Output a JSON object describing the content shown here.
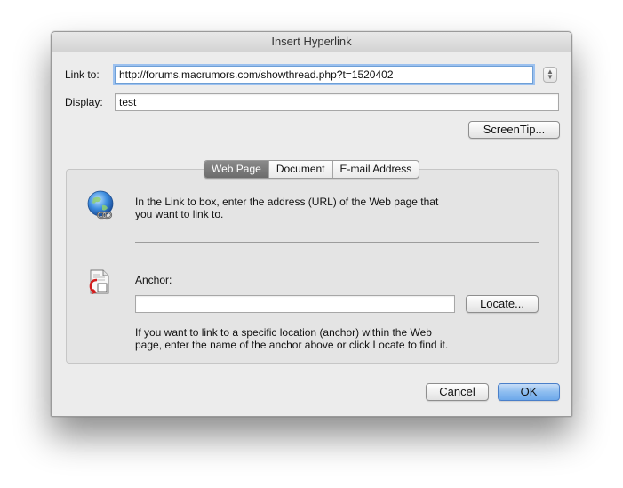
{
  "window": {
    "title": "Insert Hyperlink"
  },
  "link_to": {
    "label": "Link to:",
    "value": "http://forums.macrumors.com/showthread.php?t=1520402"
  },
  "display": {
    "label": "Display:",
    "value": "test"
  },
  "buttons": {
    "screentip": "ScreenTip...",
    "locate": "Locate...",
    "cancel": "Cancel",
    "ok": "OK"
  },
  "tabs": [
    {
      "label": "Web Page",
      "active": true
    },
    {
      "label": "Document",
      "active": false
    },
    {
      "label": "E-mail Address",
      "active": false
    }
  ],
  "web_page": {
    "instruction_line1": "In the Link to box, enter the address (URL) of the Web page that",
    "instruction_line2": "you want to link to.",
    "anchor_label": "Anchor:",
    "anchor_value": "",
    "anchor_help_line1": "If you want to link to a specific location (anchor) within the Web",
    "anchor_help_line2": "page, enter the name of the anchor above or click Locate to find it."
  },
  "icons": {
    "web_link": "globe-link-icon",
    "anchor": "anchor-document-icon"
  },
  "colors": {
    "accent": "#6da8ea",
    "focus_ring": "#9cc1ef"
  }
}
